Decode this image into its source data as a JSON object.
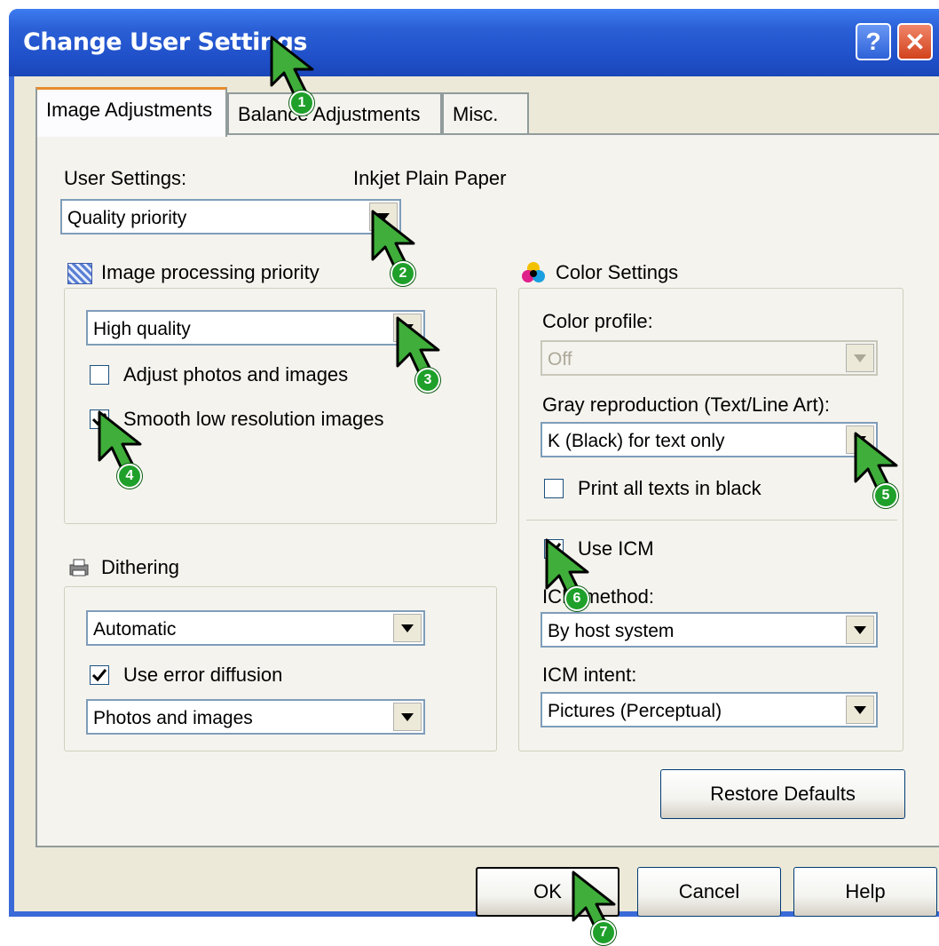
{
  "window": {
    "title": "Change User Settings",
    "help_label": "?",
    "close_label": "✕"
  },
  "tabs": [
    {
      "label": "Image Adjustments",
      "active": true
    },
    {
      "label": "Balance Adjustments",
      "active": false
    },
    {
      "label": "Misc.",
      "active": false
    }
  ],
  "user_settings": {
    "label": "User Settings:",
    "media": "Inkjet Plain Paper",
    "value": "Quality priority"
  },
  "image_processing": {
    "title": "Image processing priority",
    "value": "High quality",
    "adjust_photos": {
      "label": "Adjust photos and images",
      "checked": false
    },
    "smooth_low_res": {
      "label": "Smooth low resolution images",
      "checked": true
    }
  },
  "dithering": {
    "title": "Dithering",
    "value": "Automatic",
    "error_diffusion": {
      "label": "Use error diffusion",
      "checked": true
    },
    "mode_value": "Photos and images"
  },
  "color_settings": {
    "title": "Color Settings",
    "profile_label": "Color profile:",
    "profile_value": "Off",
    "gray_label": "Gray reproduction (Text/Line Art):",
    "gray_value": "K (Black) for text only",
    "print_black": {
      "label": "Print all texts in black",
      "checked": false
    },
    "use_icm": {
      "label": "Use ICM",
      "checked": true
    },
    "icm_method_label": "ICM method:",
    "icm_method_value": "By host system",
    "icm_intent_label": "ICM intent:",
    "icm_intent_value": "Pictures (Perceptual)"
  },
  "buttons": {
    "restore": "Restore Defaults",
    "ok": "OK",
    "cancel": "Cancel",
    "help": "Help"
  },
  "callouts": [
    "1",
    "2",
    "3",
    "4",
    "5",
    "6",
    "7"
  ],
  "colors": {
    "title_bar": "#2a5fd6",
    "callout_green": "#1fa02a",
    "dialog_bg": "#ece9d8"
  }
}
